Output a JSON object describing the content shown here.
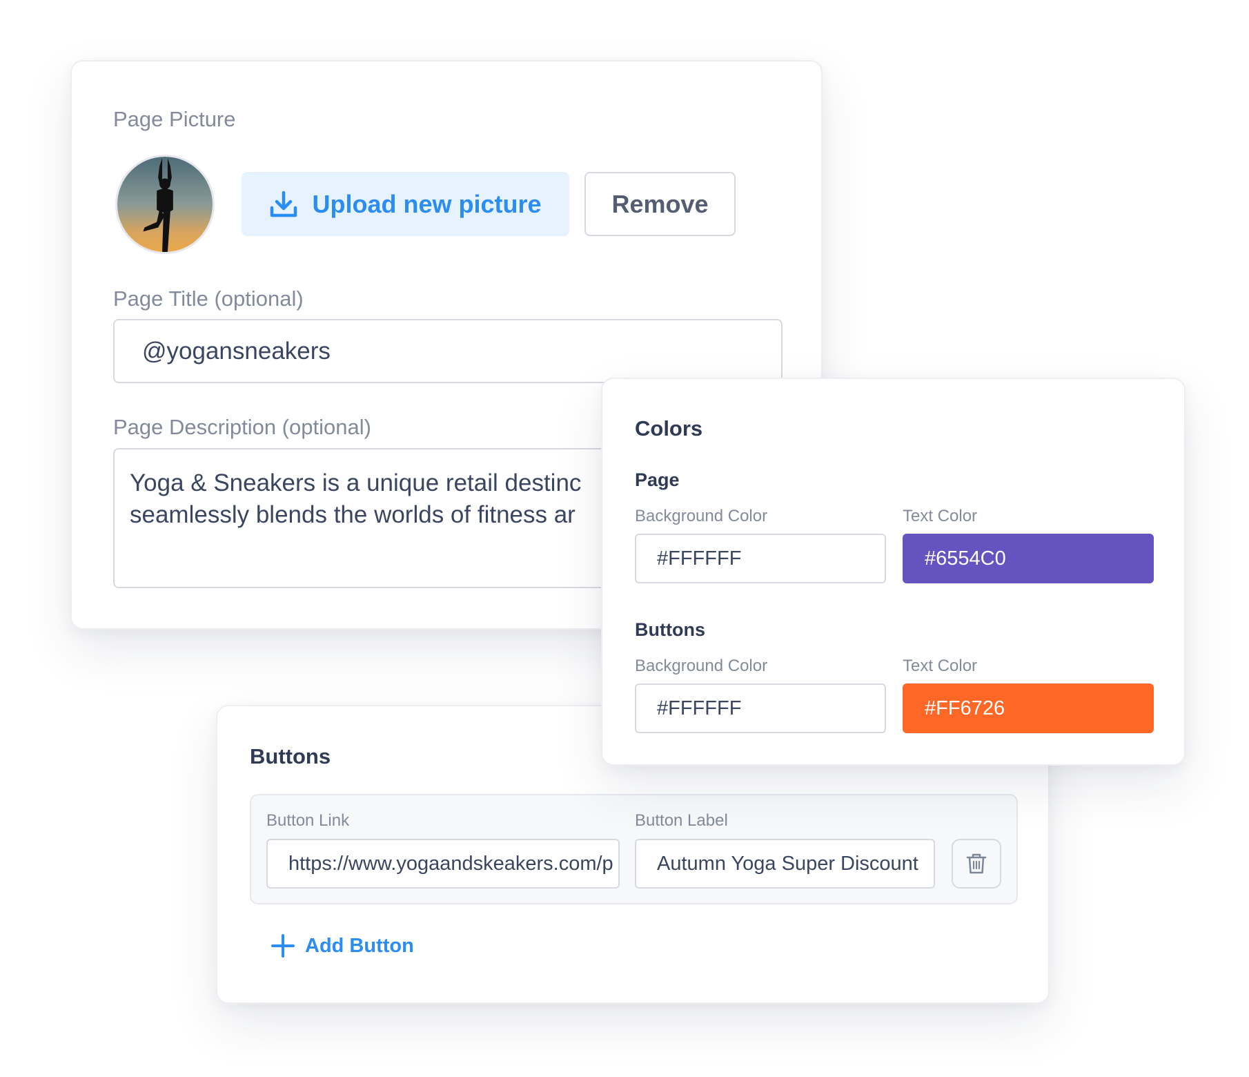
{
  "profile": {
    "picture_label": "Page Picture",
    "upload_label": "Upload new picture",
    "remove_label": "Remove",
    "title_label": "Page Title (optional)",
    "title_value": "@yogansneakers",
    "description_label": "Page Description (optional)",
    "description_line1": "Yoga & Sneakers is a unique retail destinc",
    "description_line2": "seamlessly blends the worlds of fitness ar"
  },
  "colors": {
    "title": "Colors",
    "page": {
      "heading": "Page",
      "bg_label": "Background Color",
      "bg_value": "#FFFFFF",
      "text_label": "Text Color",
      "text_value": "#6554C0"
    },
    "buttons": {
      "heading": "Buttons",
      "bg_label": "Background Color",
      "bg_value": "#FFFFFF",
      "text_label": "Text Color",
      "text_value": "#FF6726"
    }
  },
  "buttons_card": {
    "title": "Buttons",
    "link_label": "Button Link",
    "link_value": "https://www.yogaandskeakers.com/p",
    "label_label": "Button Label",
    "label_value": "Autumn Yoga Super Discount",
    "add_label": "Add Button"
  },
  "icons": {
    "upload": "download-arrow-icon",
    "delete": "trash-icon",
    "add": "plus-icon"
  },
  "theme": {
    "accent": "#2B8CF2",
    "page_text_color": "#6554C0",
    "buttons_text_color": "#FF6726"
  }
}
